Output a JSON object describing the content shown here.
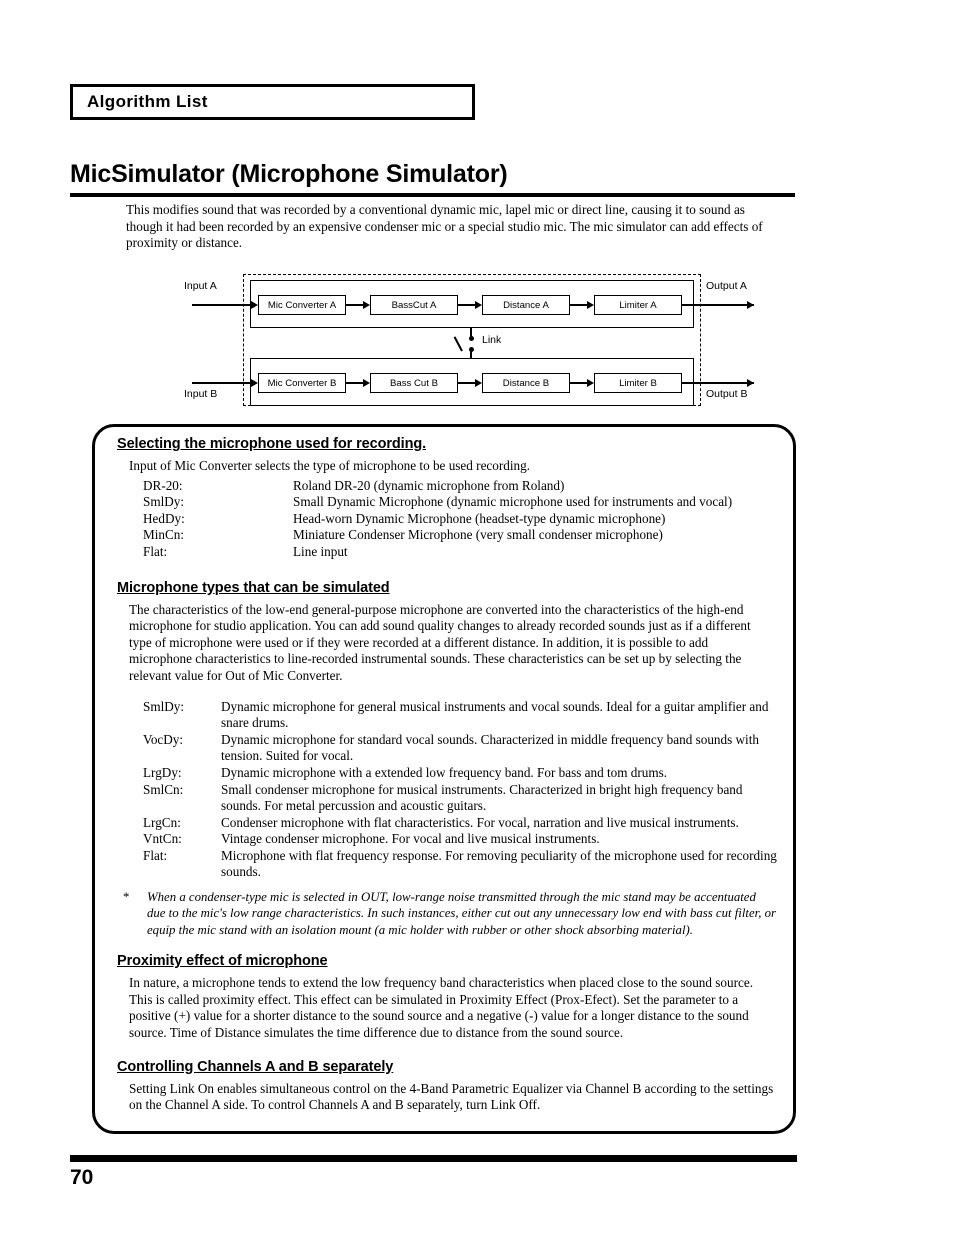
{
  "header": {
    "chapter_label": "Algorithm List"
  },
  "title": "MicSimulator (Microphone Simulator)",
  "intro": "This modifies sound that was recorded by a conventional dynamic mic, lapel mic or direct line, causing it to sound as though it had been recorded by an expensive condenser mic or a special studio mic. The mic simulator can add effects of proximity or distance.",
  "diagram": {
    "input_a": "Input A",
    "input_b": "Input B",
    "output_a": "Output A",
    "output_b": "Output B",
    "link_label": "Link",
    "channel_a": [
      "Mic Converter A",
      "BassCut A",
      "Distance A",
      "Limiter A"
    ],
    "channel_b": [
      "Mic Converter B",
      "Bass Cut B",
      "Distance B",
      "Limiter B"
    ]
  },
  "sections": {
    "selecting": {
      "heading": "Selecting the microphone used for recording.",
      "intro": "Input of Mic Converter selects the type of microphone to be used recording.",
      "items": [
        {
          "term": "DR-20:",
          "desc": "Roland DR-20 (dynamic microphone from Roland)"
        },
        {
          "term": "SmlDy:",
          "desc": "Small Dynamic Microphone (dynamic microphone used for instruments and vocal)"
        },
        {
          "term": "HedDy:",
          "desc": "Head-worn Dynamic Microphone (headset-type dynamic microphone)"
        },
        {
          "term": "MinCn:",
          "desc": "Miniature Condenser Microphone (very small condenser microphone)"
        },
        {
          "term": "Flat:",
          "desc": "Line input"
        }
      ]
    },
    "mic_types": {
      "heading": "Microphone types that can be simulated",
      "para": "The characteristics of the low-end general-purpose microphone are converted into the characteristics of the high-end microphone for studio application. You can add sound quality changes to already recorded sounds just as if a different type of microphone were used or if they were recorded at a different distance. In addition, it is possible to add microphone characteristics to line-recorded instrumental sounds. These characteristics can be set up by selecting the relevant value for Out of Mic Converter.",
      "items": [
        {
          "term": "SmlDy:",
          "desc": "Dynamic microphone for general musical instruments and vocal sounds. Ideal for a guitar amplifier and snare drums."
        },
        {
          "term": "VocDy:",
          "desc": "Dynamic microphone for standard vocal sounds. Characterized in middle frequency band sounds with tension. Suited for vocal."
        },
        {
          "term": "LrgDy:",
          "desc": "Dynamic microphone with a extended low frequency band. For bass and tom drums."
        },
        {
          "term": "SmlCn:",
          "desc": "Small condenser microphone for musical instruments. Characterized in bright high frequency band sounds. For metal percussion and acoustic guitars."
        },
        {
          "term": "LrgCn:",
          "desc": "Condenser microphone with flat characteristics. For vocal, narration and live musical instruments."
        },
        {
          "term": "VntCn:",
          "desc": "Vintage condenser microphone. For vocal and live musical instruments."
        },
        {
          "term": "Flat:",
          "desc": "Microphone with flat frequency response. For removing peculiarity of the microphone used for recording sounds."
        }
      ],
      "note_marker": "*",
      "note": "When a condenser-type mic is selected in OUT, low-range noise transmitted through the mic stand may be accentuated due to the mic's low range characteristics. In such instances, either cut out any unnecessary low end with bass cut filter, or equip the mic stand with an isolation mount (a mic holder with rubber or other shock absorbing material)."
    },
    "proximity": {
      "heading": "Proximity effect of microphone",
      "para": "In nature, a microphone tends to extend the low frequency band characteristics when placed close to the sound source. This is called proximity effect. This effect can be simulated in Proximity Effect (Prox-Efect). Set the parameter to a positive (+) value for a shorter distance to the sound source and a negative (-) value for a longer distance to the sound source. Time of Distance simulates the time difference due to distance from the sound source."
    },
    "link_control": {
      "heading": "Controlling Channels A and B separately",
      "para": "Setting Link On enables simultaneous control on the 4-Band Parametric Equalizer via Channel B according to the settings on the Channel A side. To control Channels A and B separately, turn Link Off."
    }
  },
  "footer": {
    "page_number": "70"
  }
}
